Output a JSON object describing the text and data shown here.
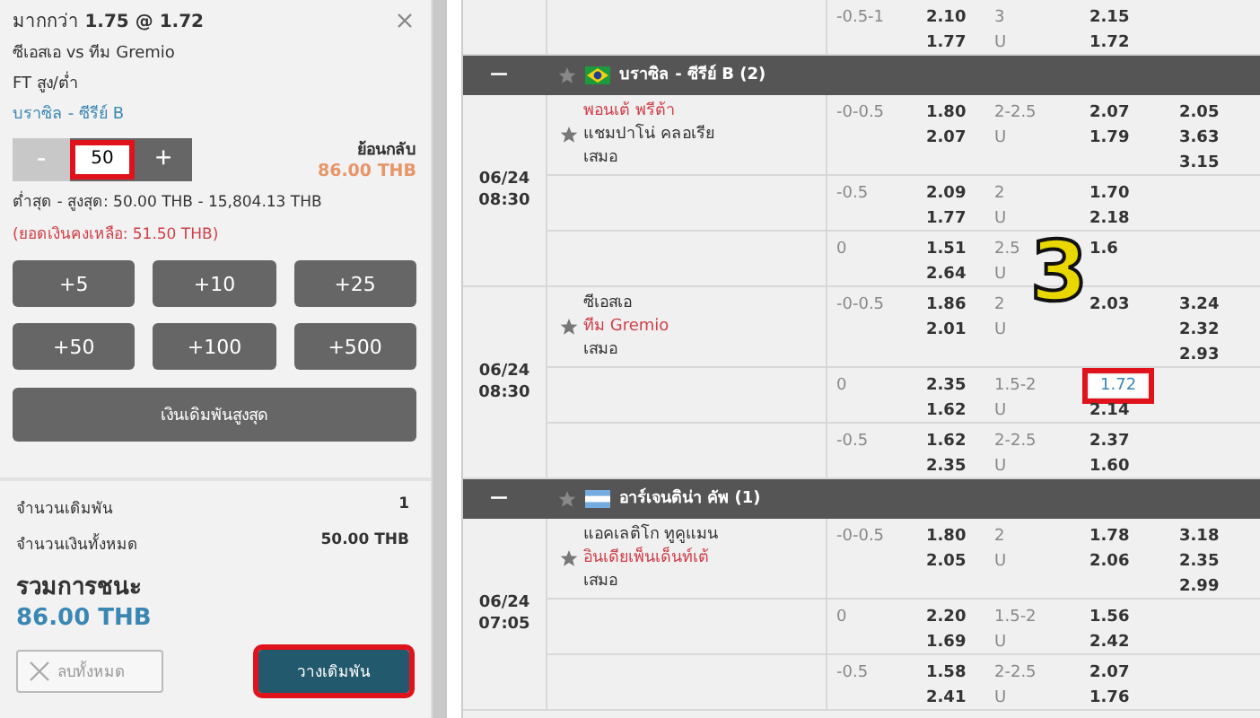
{
  "bet_slip": {
    "title": "มากกว่า **1.75 @ 1.72**",
    "match": "ซีเอสเอ vs ทีม Gremio",
    "market": "FT สูง/ต่ำ",
    "league": "บราซิล - ซีรีย์ B",
    "stepper": {
      "minus": "-",
      "minus_disabled": true,
      "value": "50",
      "value_highlighted": true,
      "plus": "+"
    },
    "return_label": "ย้อนกลับ",
    "return_value": "86.00 THB",
    "limits": "ต่ำสุด - สูงสุด: 50.00 THB - 15,804.13 THB",
    "balance": "(ยอดเงินคงเหลือ: 51.50 THB)",
    "quick_stakes": [
      "+5",
      "+10",
      "+25",
      "+50",
      "+100",
      "+500"
    ],
    "max_stake": "เงินเดิมพันสูงสุด",
    "summary": [
      {
        "label": "จำนวนเดิมพัน",
        "value": "1"
      },
      {
        "label": "จำนวนเงินทั้งหมด",
        "value": "50.00 THB"
      }
    ],
    "total_win_label": "รวมการชนะ",
    "total_win": "86.00 THB",
    "clear_button": {
      "label": "ลบทั้งหมด",
      "disabled": true
    },
    "place_button": {
      "label": "วางเดิมพัน",
      "highlighted": true
    }
  },
  "table": {
    "top_partial": {
      "hdp": "-0.5-1",
      "hdp_odds": [
        "2.10",
        "1.77"
      ],
      "ou": "3",
      "ou_side": "U",
      "ou_odds": [
        "2.15",
        "1.72"
      ]
    },
    "leagues": [
      {
        "name": "บราซิล - ซีรีย์ B (2)",
        "kind": "brazil",
        "expanded": true,
        "collapse": "—",
        "matches": [
          {
            "date": "06/24",
            "time": "08:30",
            "teams": [
              {
                "name": "พอนเต้ พรีต้า",
                "favourite": true
              },
              {
                "name": "แชมปาโน่ คลอเรีย",
                "favourite": false
              },
              {
                "name": "เสมอ",
                "favourite": false
              }
            ],
            "x12": [
              "2.05",
              "3.63",
              "3.15"
            ],
            "lines": [
              {
                "hdp": "-0-0.5",
                "hdp_odds": [
                  "1.80",
                  "2.07"
                ],
                "ou": "2-2.5",
                "ou_side": "U",
                "ou_odds": [
                  "2.07",
                  "1.79"
                ],
                "selected": false
              },
              {
                "hdp": "-0.5",
                "hdp_odds": [
                  "2.09",
                  "1.77"
                ],
                "ou": "2",
                "ou_side": "U",
                "ou_odds": [
                  "1.70",
                  "2.18"
                ],
                "selected": false
              },
              {
                "hdp": "0",
                "hdp_odds": [
                  "1.51",
                  "2.64"
                ],
                "ou": "2.5",
                "ou_side": "U",
                "ou_odds": [
                  "1.6"
                ],
                "selected": false
              }
            ]
          },
          {
            "date": "06/24",
            "time": "08:30",
            "teams": [
              {
                "name": "ซีเอสเอ",
                "favourite": false
              },
              {
                "name": "ทีม Gremio",
                "favourite": true
              },
              {
                "name": "เสมอ",
                "favourite": false
              }
            ],
            "x12": [
              "3.24",
              "2.32",
              "2.93"
            ],
            "lines": [
              {
                "hdp": "-0-0.5",
                "hdp_odds": [
                  "1.86",
                  "2.01"
                ],
                "ou": "2",
                "ou_side": "U",
                "ou_odds": [
                  "2.03"
                ],
                "selected": false
              },
              {
                "hdp": "0",
                "hdp_odds": [
                  "2.35",
                  "1.62"
                ],
                "ou": "1.5-2",
                "ou_side": "U",
                "ou_odds": [
                  "1.72",
                  "2.14"
                ],
                "selected": true
              },
              {
                "hdp": "-0.5",
                "hdp_odds": [
                  "1.62",
                  "2.35"
                ],
                "ou": "2-2.5",
                "ou_side": "U",
                "ou_odds": [
                  "2.37",
                  "1.60"
                ],
                "selected": false
              }
            ]
          }
        ]
      },
      {
        "name": "อาร์เจนติน่า คัพ (1)",
        "kind": "argentina",
        "expanded": true,
        "collapse": "—",
        "matches": [
          {
            "date": "06/24",
            "time": "07:05",
            "teams": [
              {
                "name": "แอคเลติโก ทูคูแมน",
                "favourite": false
              },
              {
                "name": "อินเดียเพ็นเด็นท์เต้",
                "favourite": true
              },
              {
                "name": "เสมอ",
                "favourite": false
              }
            ],
            "x12": [
              "3.18",
              "2.35",
              "2.99"
            ],
            "lines": [
              {
                "hdp": "-0-0.5",
                "hdp_odds": [
                  "1.80",
                  "2.05"
                ],
                "ou": "2",
                "ou_side": "U",
                "ou_odds": [
                  "1.78",
                  "2.06"
                ],
                "selected": false
              },
              {
                "hdp": "0",
                "hdp_odds": [
                  "2.20",
                  "1.69"
                ],
                "ou": "1.5-2",
                "ou_side": "U",
                "ou_odds": [
                  "1.56",
                  "2.42"
                ],
                "selected": false
              },
              {
                "hdp": "-0.5",
                "hdp_odds": [
                  "1.58",
                  "2.41"
                ],
                "ou": "2-2.5",
                "ou_side": "U",
                "ou_odds": [
                  "2.07",
                  "1.76"
                ],
                "selected": false
              }
            ]
          }
        ]
      }
    ]
  },
  "step_marker": "3"
}
